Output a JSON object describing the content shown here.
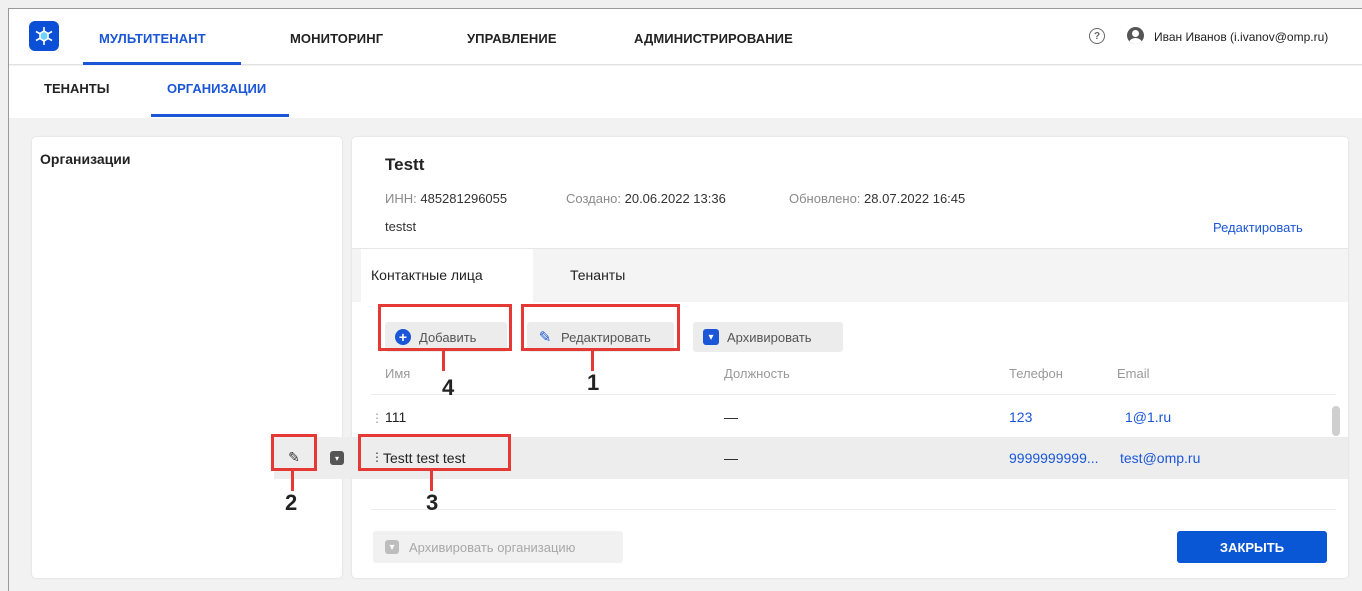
{
  "topnav": {
    "items": [
      {
        "label": "МУЛЬТИТЕНАНТ",
        "active": true
      },
      {
        "label": "МОНИТОРИНГ",
        "active": false
      },
      {
        "label": "УПРАВЛЕНИЕ",
        "active": false
      },
      {
        "label": "АДМИНИСТРИРОВАНИЕ",
        "active": false
      }
    ],
    "help": "?",
    "user": "Иван Иванов (i.ivanov@omp.ru)"
  },
  "subnav": {
    "items": [
      {
        "label": "ТЕНАНТЫ",
        "active": false
      },
      {
        "label": "ОРГАНИЗАЦИИ",
        "active": true
      }
    ]
  },
  "left_panel": {
    "title": "Организации"
  },
  "org": {
    "name": "Testt",
    "inn_label": "ИНН:",
    "inn": "485281296055",
    "created_label": "Создано:",
    "created": "20.06.2022 13:36",
    "updated_label": "Обновлено:",
    "updated": "28.07.2022 16:45",
    "description": "testst",
    "edit_link": "Редактировать"
  },
  "tabs": [
    {
      "label": "Контактные лица",
      "active": true
    },
    {
      "label": "Тенанты",
      "active": false
    }
  ],
  "toolbar": {
    "add": "Добавить",
    "edit": "Редактировать",
    "archive": "Архивировать"
  },
  "table": {
    "headers": [
      "Имя",
      "Должность",
      "Телефон",
      "Email"
    ],
    "rows": [
      {
        "name": "111",
        "position": "—",
        "phone": "123",
        "email": "1@1.ru"
      },
      {
        "name": "Testt test test",
        "position": "—",
        "phone": "9999999999...",
        "email": "test@omp.ru"
      }
    ]
  },
  "footer": {
    "archive_org": "Архивировать организацию",
    "close": "ЗАКРЫТЬ"
  },
  "annotations": [
    "1",
    "2",
    "3",
    "4"
  ],
  "colors": {
    "accent": "#1a56d6",
    "annotation": "#e53935"
  }
}
